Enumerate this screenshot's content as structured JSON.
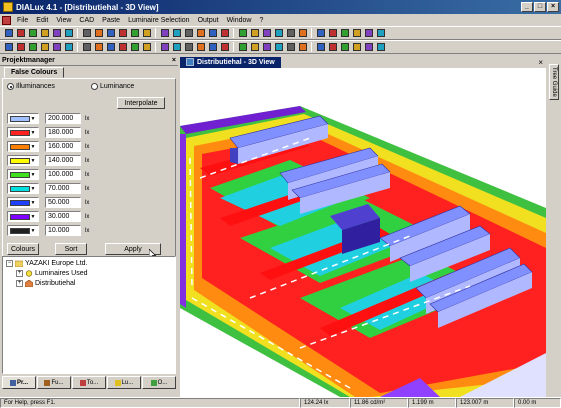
{
  "window": {
    "title": "DIALux 4.1 - [Distributiehal - 3D View]"
  },
  "menu": {
    "items": [
      "File",
      "Edit",
      "View",
      "CAD",
      "Paste",
      "Luminaire Selection",
      "Output",
      "Window",
      "?"
    ]
  },
  "toolbar1": {
    "icons": [
      "new-icon",
      "open-icon",
      "save-icon",
      "print-icon",
      "pdf-icon",
      "undo-icon",
      "redo-icon",
      "cut-icon",
      "copy-icon",
      "paste-icon",
      "room-icon",
      "exterior-icon",
      "street-icon",
      "luminaire-icon",
      "arrange-icon",
      "field-icon",
      "line-icon",
      "circle-icon",
      "rect-icon",
      "select-icon",
      "rotate-icon",
      "calc-icon",
      "stop-icon",
      "light-icon",
      "colour-icon",
      "wizard-icon",
      "help-icon",
      "pointer-icon",
      "grid-icon",
      "more-icon"
    ]
  },
  "toolbar2": {
    "icons": [
      "select-mode-icon",
      "pan-icon",
      "zoom-icon",
      "orbit-icon",
      "walk-icon",
      "front-icon",
      "side-icon",
      "top-icon",
      "perspective-icon",
      "wire-icon",
      "fill-icon",
      "render-icon",
      "raytrace-icon",
      "zoom-in-icon",
      "zoom-out-icon",
      "zoom-all-icon",
      "rotate-left-icon",
      "rotate-right-icon",
      "light-on-icon",
      "light-off-icon",
      "snap-icon",
      "dim-icon",
      "measure-icon",
      "export-icon",
      "camera-icon",
      "mesh-icon",
      "grid2-icon",
      "axis-icon",
      "info-icon",
      "end-icon"
    ]
  },
  "projectmanager": {
    "title": "Projektmanager",
    "close": "×",
    "tab": "False Colours",
    "radio_illuminances": "Illuminances",
    "radio_luminance": "Luminance",
    "interpolate": "Interpolate",
    "rows": [
      {
        "color": "#a0c0ff",
        "value": "200.000",
        "unit": "lx"
      },
      {
        "color": "#ff2020",
        "value": "180.000",
        "unit": "lx"
      },
      {
        "color": "#ff8000",
        "value": "160.000",
        "unit": "lx"
      },
      {
        "color": "#ffff00",
        "value": "140.000",
        "unit": "lx"
      },
      {
        "color": "#40e020",
        "value": "100.000",
        "unit": "lx"
      },
      {
        "color": "#00e0e0",
        "value": "70.000",
        "unit": "lx"
      },
      {
        "color": "#2040ff",
        "value": "50.000",
        "unit": "lx"
      },
      {
        "color": "#8000ff",
        "value": "30.000",
        "unit": "lx"
      },
      {
        "color": "#202020",
        "value": "10.000",
        "unit": "lx"
      }
    ],
    "btn_colours": "Colours",
    "btn_sort": "Sort",
    "btn_apply": "Apply"
  },
  "tree": {
    "root": "YAZAKI Europe Ltd.",
    "child1": "Luminaires Used",
    "child2": "Distributiehal"
  },
  "bottom_tabs": [
    "Pr...",
    "Fu...",
    "To...",
    "Lu...",
    "O..."
  ],
  "doc": {
    "tab_label": "Distributiehal - 3D View",
    "close": "×"
  },
  "side": {
    "tree_guide": "Tree Guide"
  },
  "status": {
    "help": "For Help, press F1.",
    "lux": "124.24 lx",
    "luminance": "11.86 cd/m²",
    "x": "1.199 m",
    "y": "123.007 m",
    "z": "0.00 m"
  }
}
